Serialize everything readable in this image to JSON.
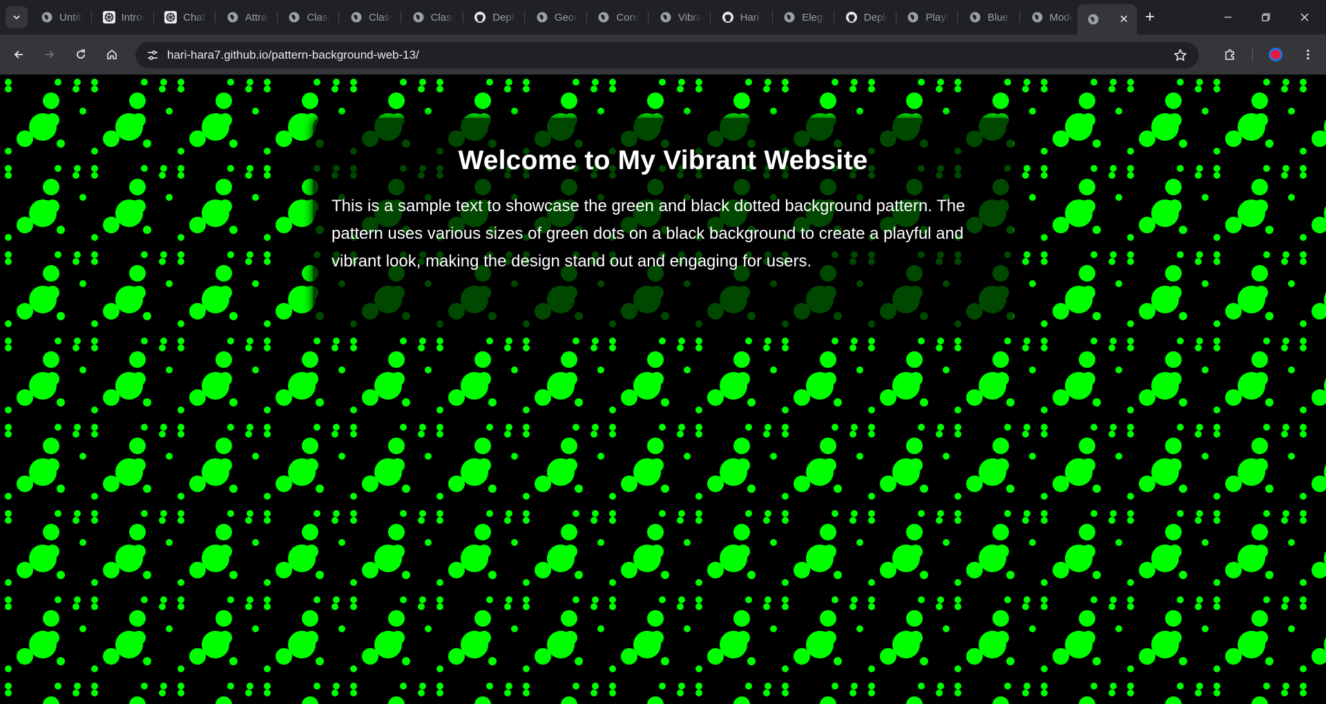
{
  "browser": {
    "tabs": [
      {
        "title": "Untitled",
        "icon": "globe-icon"
      },
      {
        "title": "Introduction",
        "icon": "openai-icon"
      },
      {
        "title": "ChatGPT",
        "icon": "openai-icon"
      },
      {
        "title": "Attractive",
        "icon": "globe-icon"
      },
      {
        "title": "Classic",
        "icon": "globe-icon"
      },
      {
        "title": "Classic",
        "icon": "globe-icon"
      },
      {
        "title": "Classic",
        "icon": "globe-icon"
      },
      {
        "title": "Deploy",
        "icon": "github-icon"
      },
      {
        "title": "Geometric",
        "icon": "globe-icon"
      },
      {
        "title": "Consistent",
        "icon": "globe-icon"
      },
      {
        "title": "Vibrant",
        "icon": "globe-icon"
      },
      {
        "title": "Hari",
        "icon": "github-icon"
      },
      {
        "title": "Elegant",
        "icon": "globe-icon"
      },
      {
        "title": "Deploy",
        "icon": "github-icon"
      },
      {
        "title": "Playful",
        "icon": "globe-icon"
      },
      {
        "title": "Blue",
        "icon": "globe-icon"
      },
      {
        "title": "Modern",
        "icon": "globe-icon"
      }
    ],
    "active_tab": {
      "title": "",
      "icon": "globe-icon"
    },
    "new_tab_label": "+",
    "url": "hari-hara7.github.io/pattern-background-web-13/",
    "colors": {
      "tab_strip": "#202124",
      "toolbar": "#35363a",
      "omnibox": "#202124"
    }
  },
  "page": {
    "heading": "Welcome to My Vibrant Website",
    "paragraph": "This is a sample text to showcase the green and black dotted background pattern. The pattern uses various sizes of green dots on a black background to create a playful and vibrant look, making the design stand out and engaging for users.",
    "colors": {
      "background": "#000000",
      "dot": "#00ff00",
      "text": "#ffffff"
    }
  }
}
